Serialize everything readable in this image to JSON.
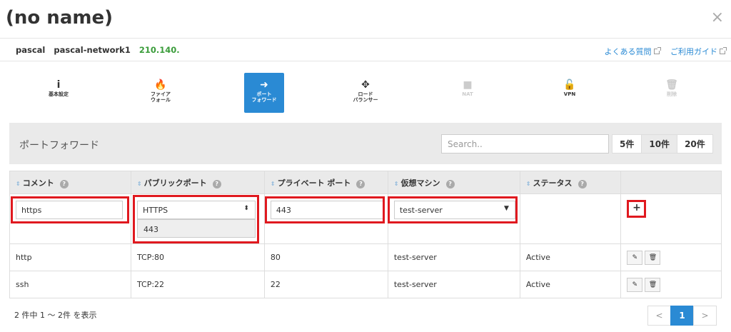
{
  "window": {
    "title": "(no name)",
    "close_label": "×"
  },
  "info": {
    "user": "pascal",
    "network": "pascal-network1",
    "ip": "210.140.",
    "faq_link": "よくある質問",
    "guide_link": "ご利用ガイド"
  },
  "tabs": [
    {
      "icon": "info-icon",
      "glyph": "i",
      "label": "基本設定"
    },
    {
      "icon": "flame-icon",
      "glyph": "🔥",
      "label": "ファイア\nウォール"
    },
    {
      "icon": "sign-in-icon",
      "glyph": "➜",
      "label": "ポート\nフォワード"
    },
    {
      "icon": "arrows-expand-icon",
      "glyph": "✥",
      "label": "ロード\nバランサー"
    },
    {
      "icon": "square-icon",
      "glyph": "■",
      "label": "NAT"
    },
    {
      "icon": "unlock-icon",
      "glyph": "🔓",
      "label": "VPN"
    },
    {
      "icon": "trash-icon",
      "glyph": "🗑",
      "label": "削除"
    }
  ],
  "panel": {
    "title": "ポートフォワード",
    "search_placeholder": "Search..",
    "page_sizes": [
      "5件",
      "10件",
      "20件"
    ]
  },
  "table": {
    "headers": [
      "コメント",
      "パブリックポート",
      "プライベート ポート",
      "仮想マシン",
      "ステータス"
    ],
    "new_row": {
      "comment": "https",
      "public_port": "HTTPS",
      "public_port_option": "443",
      "private_port": "443",
      "vm": "test-server",
      "add_label": "+"
    },
    "rows": [
      {
        "comment": "http",
        "public_port": "TCP:80",
        "private_port": "80",
        "vm": "test-server",
        "status": "Active"
      },
      {
        "comment": "ssh",
        "public_port": "TCP:22",
        "private_port": "22",
        "vm": "test-server",
        "status": "Active"
      }
    ]
  },
  "footer": {
    "count_text": "2 件中 1 ～ 2件 を表示",
    "prev": "<",
    "page": "1",
    "next": ">"
  },
  "colors": {
    "accent": "#2a8ad4",
    "status_active": "#3a9c3a",
    "highlight": "#e0191f"
  }
}
